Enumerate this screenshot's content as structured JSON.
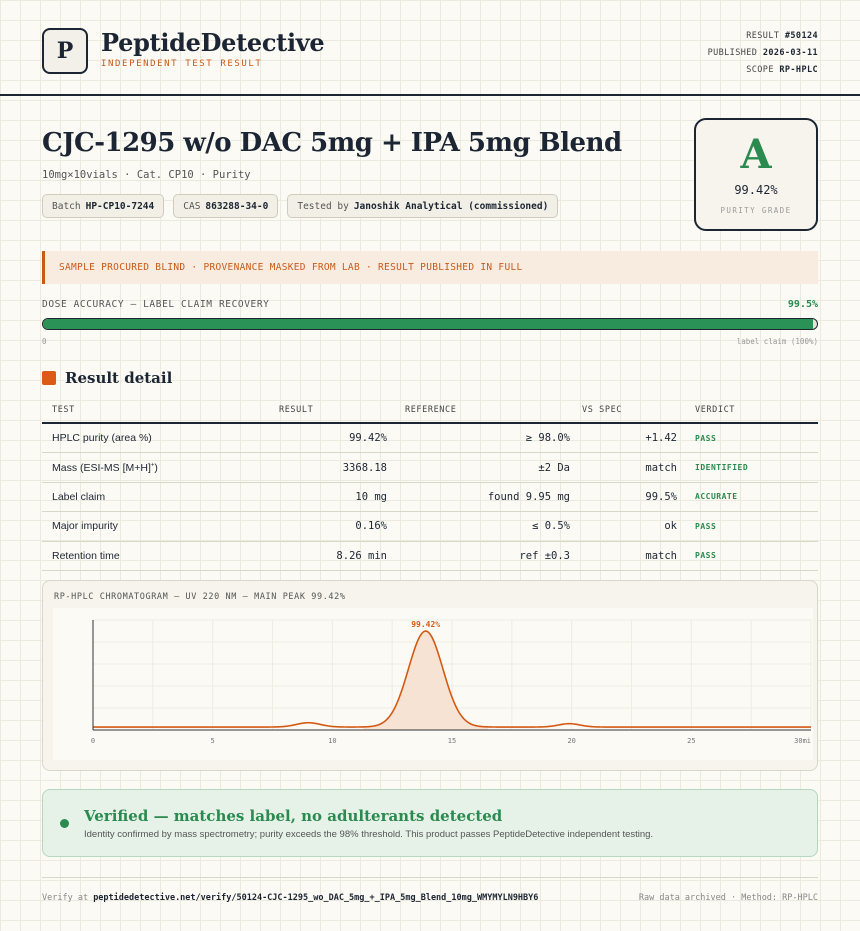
{
  "header": {
    "logo_letter": "P",
    "brand": "PeptideDetective",
    "tagline": "INDEPENDENT TEST RESULT",
    "meta": [
      {
        "label": "RESULT",
        "value": "#50124"
      },
      {
        "label": "PUBLISHED",
        "value": "2026-03-11"
      },
      {
        "label": "SCOPE",
        "value": "RP-HPLC"
      }
    ]
  },
  "product": {
    "title": "CJC-1295 w/o DAC 5mg + IPA 5mg Blend",
    "subline": "10mg×10vials · Cat. CP10 · Purity",
    "chips": [
      {
        "label": "Batch",
        "value": "HP-CP10-7244"
      },
      {
        "label": "CAS",
        "value": "863288-34-0"
      },
      {
        "label": "Tested by",
        "value": "Janoshik Analytical (commissioned)"
      }
    ]
  },
  "grade": {
    "letter": "A",
    "value": "99.42%",
    "label": "PURITY GRADE"
  },
  "banner": "SAMPLE PROCURED BLIND · PROVENANCE MASKED FROM LAB · RESULT PUBLISHED IN FULL",
  "dose": {
    "label": "DOSE ACCURACY — LABEL CLAIM RECOVERY",
    "value_text": "99.5%",
    "fraction": 0.995,
    "min_label": "0",
    "max_label": "label claim (100%)"
  },
  "results": {
    "title": "Result detail",
    "columns": [
      "TEST",
      "RESULT",
      "REFERENCE",
      "VS SPEC",
      "VERDICT"
    ],
    "rows": [
      {
        "test": "HPLC purity (area %)",
        "result": "99.42%",
        "reference": "≥ 98.0%",
        "vs_spec": "+1.42",
        "verdict": "PASS"
      },
      {
        "test": "Mass (ESI-MS [M+H]",
        "test_sup": "+",
        "test_end": ")",
        "result": "3368.18",
        "reference": "±2 Da",
        "vs_spec": "match",
        "verdict": "IDENTIFIED"
      },
      {
        "test": "Label claim",
        "result": "10 mg",
        "reference": "found 9.95 mg",
        "vs_spec": "99.5%",
        "verdict": "ACCURATE"
      },
      {
        "test": "Major impurity",
        "result": "0.16%",
        "reference": "≤ 0.5%",
        "vs_spec": "ok",
        "verdict": "PASS"
      },
      {
        "test": "Retention time",
        "result": "8.26 min",
        "reference": "ref ±0.3",
        "vs_spec": "match",
        "verdict": "PASS"
      }
    ]
  },
  "chart_data": {
    "type": "line",
    "title": "RP-HPLC CHROMATOGRAM — UV 220 NM — MAIN PEAK 99.42%",
    "xlim": [
      0,
      30
    ],
    "ylim": [
      0,
      100
    ],
    "x_ticks": [
      "0",
      "5",
      "10",
      "15",
      "20",
      "25",
      "30"
    ],
    "x_unit_label": "min",
    "peaks": [
      {
        "x": 9.0,
        "height": 4.5,
        "width": 0.5
      },
      {
        "x": 13.9,
        "height": 100,
        "width": 0.72
      },
      {
        "x": 19.9,
        "height": 3.5,
        "width": 0.45
      }
    ],
    "baseline": 1.0,
    "peak_label": "99.42%",
    "line_color": "#d45a14",
    "fill_color": "#f6e3d4"
  },
  "verified": {
    "title": "Verified — matches label, no adulterants detected",
    "body": "Identity confirmed by mass spectrometry; purity exceeds the 98% threshold. This product passes PeptideDetective independent testing."
  },
  "footer": {
    "verify_prefix": "Verify at",
    "verify_url": "peptidedetective.net/verify/50124-CJC-1295_wo_DAC_5mg_+_IPA_5mg_Blend_10mg_WMYMYLN9HBY6",
    "right": "Raw data archived · Method: RP-HPLC"
  },
  "colors": {
    "accent": "#c85a16",
    "pass": "#2a8a4f",
    "ink": "#1c2533"
  }
}
